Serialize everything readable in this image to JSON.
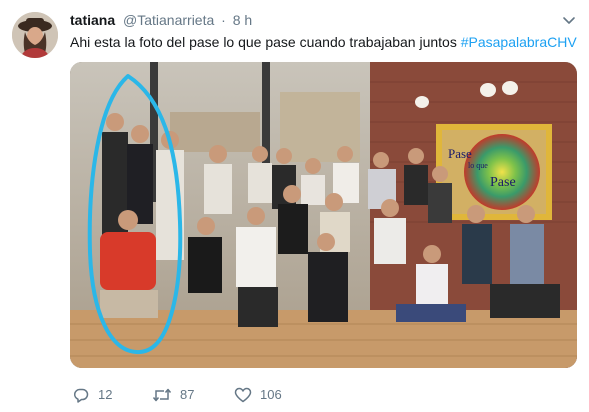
{
  "tweet": {
    "display_name": "tatiana",
    "handle": "@Tatianarrieta",
    "separator": "·",
    "time": "8 h",
    "text": "Ahi esta la foto del pase lo que pase cuando trabajaban juntos ",
    "hashtag": "#PasapalabraCHV",
    "photo_sign_lines": [
      "Pase",
      "lo que",
      "Pase"
    ]
  },
  "actions": {
    "reply_count": "12",
    "retweet_count": "87",
    "like_count": "106"
  },
  "icons": {
    "menu": "chevron-down-icon",
    "reply": "reply-icon",
    "retweet": "retweet-icon",
    "like": "heart-icon"
  },
  "colors": {
    "link": "#1da1f2",
    "secondary_text": "#657786",
    "circle_annotation": "#2bb7e8"
  }
}
